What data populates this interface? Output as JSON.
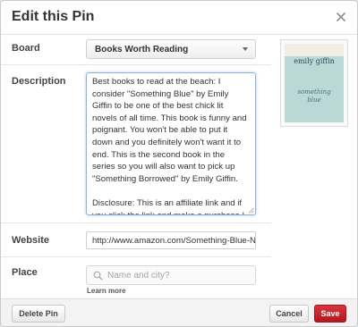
{
  "dialog": {
    "title": "Edit this Pin"
  },
  "board": {
    "label": "Board",
    "selected": "Books Worth Reading"
  },
  "description": {
    "label": "Description",
    "paragraphs": [
      "Best books to read at the beach: I consider \"Something Blue\" by Emily Giffin to be one of the best chick lit novels of all time. This book is funny and poignant. You won't be able to put it down and you definitely won't want it to end. This is the second book in the series so you will also want to pick up \"Something Borrowed\" by Emily Giffin.",
      "Disclosure: This is an affiliate link and if you click the link and make a purchase I will receive a commission. This does not increase the cost to you."
    ]
  },
  "website": {
    "label": "Website",
    "value": "http://www.amazon.com/Something-Blue-Nove"
  },
  "place": {
    "label": "Place",
    "placeholder": "Name and city?",
    "learn_more": "Learn more"
  },
  "thumbnail": {
    "author": "emily giffin",
    "book_title_line1": "something",
    "book_title_line2": "blue"
  },
  "footer": {
    "delete_label": "Delete Pin",
    "cancel_label": "Cancel",
    "save_label": "Save"
  },
  "icons": {
    "close": "close-icon",
    "caret": "caret-down-icon",
    "search": "search-icon"
  },
  "colors": {
    "save_button": "#c8232c",
    "cover_blue": "#b9d8d6",
    "focus_border": "#8fb3d9"
  }
}
